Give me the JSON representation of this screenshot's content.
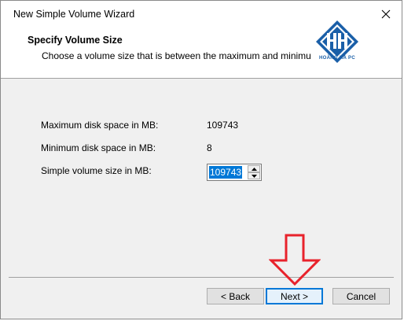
{
  "window": {
    "title": "New Simple Volume Wizard"
  },
  "header": {
    "title": "Specify Volume Size",
    "subtitle": "Choose a volume size that is between the maximum and minimum sizes.",
    "logo_caption": "HOÀNG HÀ PC"
  },
  "form": {
    "max_label": "Maximum disk space in MB:",
    "max_value": "109743",
    "min_label": "Minimum disk space in MB:",
    "min_value": "8",
    "size_label": "Simple volume size in MB:",
    "size_value": "109743"
  },
  "buttons": {
    "back": "< Back",
    "next": "Next >",
    "cancel": "Cancel"
  },
  "colors": {
    "accent": "#0078d7",
    "arrow": "#e8222b",
    "logo": "#1a5fa8"
  }
}
